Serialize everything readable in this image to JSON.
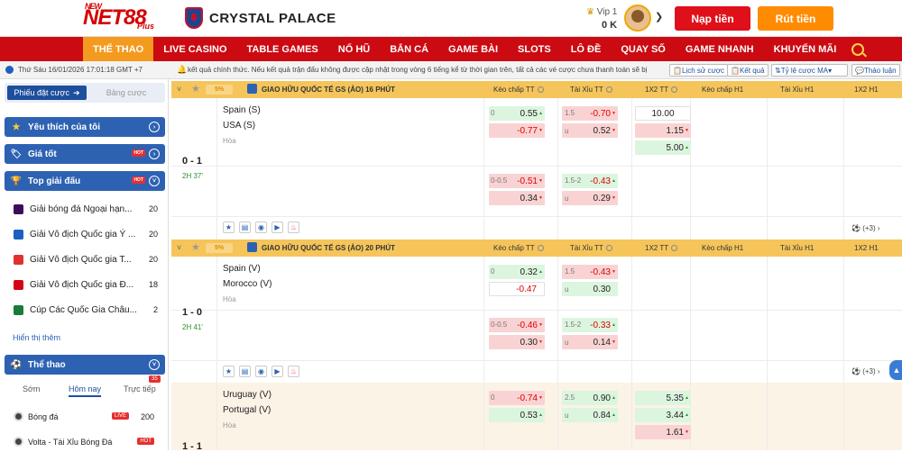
{
  "header": {
    "logo": "NET88",
    "logo_small": "NEW",
    "logo_sub": "Plus",
    "partner": "CRYSTAL PALACE",
    "vip": "Vip 1",
    "balance": "0 K",
    "deposit": "Nạp tiền",
    "withdraw": "Rút tiền"
  },
  "nav": [
    "THỂ THAO",
    "LIVE CASINO",
    "TABLE GAMES",
    "NỔ HŨ",
    "BẮN CÁ",
    "GAME BÀI",
    "SLOTS",
    "LÔ ĐỀ",
    "QUAY SỐ",
    "GAME NHANH",
    "KHUYẾN MÃI"
  ],
  "ticker": {
    "date": "Thứ Sáu 16/01/2026 17:01:18 GMT +7",
    "message": "kết quả chính thức. Nếu kết quả trận đấu không được cập nhật trong vòng 6 tiếng kể từ thời gian trên, tất cả các vé cược chưa thanh toán sẽ bị",
    "history": "Lịch sử cược",
    "results": "Kết quả",
    "odds_type": "Tỷ lệ cược MA",
    "discussion": "Thảo luận"
  },
  "sidebar": {
    "tab_betslip": "Phiếu đặt cược",
    "tab_board": "Bảng cược",
    "favorites": "Yêu thích của tôi",
    "best_odds": "Giá tốt",
    "top_leagues": "Top giải đấu",
    "hot": "HOT",
    "leagues": [
      {
        "name": "Giải bóng đá Ngoại hạn...",
        "count": "20"
      },
      {
        "name": "Giải Vô địch Quốc gia Ý ...",
        "count": "20"
      },
      {
        "name": "Giải Vô địch Quốc gia T...",
        "count": "20"
      },
      {
        "name": "Giải Vô địch Quốc gia Đ...",
        "count": "18"
      },
      {
        "name": "Cúp Các Quốc Gia Châu...",
        "count": "2"
      }
    ],
    "show_more": "Hiển thị thêm",
    "sports": "Thể thao",
    "time_tabs": {
      "early": "Sớm",
      "today": "Hôm nay",
      "live": "Trực tiếp",
      "live_count": "35"
    },
    "sport_rows": [
      {
        "name": "Bóng đá",
        "badge": "LIVE",
        "count": "200"
      },
      {
        "name": "Volta - Tài Xỉu Bóng Đá",
        "badge": "HOT"
      }
    ]
  },
  "columns": {
    "hdp": "Kèo chấp TT",
    "ou": "Tài Xỉu TT",
    "x12": "1X2 TT",
    "hdp_h1": "Kèo chấp H1",
    "ou_h1": "Tài Xỉu H1",
    "x12_h1": "1X2 H1"
  },
  "matches": [
    {
      "league": "GIAO HỮU QUỐC TẾ GS (ẢO) 16 PHÚT",
      "ribbon": "5%",
      "home": "Spain (S)",
      "away": "USA (S)",
      "draw": "Hòa",
      "score": "0 - 1",
      "time": "2H 37'",
      "more": "(+3)",
      "hdp_line": "0",
      "hdp_home": "0.55",
      "hdp_away": "-0.77",
      "ou_line": "1.5",
      "ou_over": "-0.70",
      "ou_under_label": "u",
      "ou_under": "0.52",
      "x1": "10.00",
      "x2": "1.15",
      "xd": "5.00",
      "alt": {
        "hdp_line": "0-0.5",
        "hdp_home": "-0.51",
        "hdp_away": "0.34",
        "ou_line": "1.5-2",
        "ou_over": "-0.43",
        "ou_under_label": "u",
        "ou_under": "0.29"
      }
    },
    {
      "league": "GIAO HỮU QUỐC TẾ GS (ẢO) 20 PHÚT",
      "ribbon": "5%",
      "home": "Spain (V)",
      "away": "Morocco (V)",
      "draw": "Hòa",
      "score": "1 - 0",
      "time": "2H 41'",
      "more": "(+3)",
      "hdp_line": "0",
      "hdp_home": "0.32",
      "hdp_away": "-0.47",
      "ou_line": "1.5",
      "ou_over": "-0.43",
      "ou_under_label": "u",
      "ou_under": "0.30",
      "alt": {
        "hdp_line": "0-0.5",
        "hdp_home": "-0.46",
        "hdp_away": "0.30",
        "ou_line": "1.5-2",
        "ou_over": "-0.33",
        "ou_under_label": "u",
        "ou_under": "0.14"
      }
    },
    {
      "home": "Uruguay (V)",
      "away": "Portugal (V)",
      "draw": "Hòa",
      "score": "1 - 1",
      "hdp_line": "0",
      "hdp_home": "-0.74",
      "hdp_away": "0.53",
      "ou_line": "2.5",
      "ou_over": "0.90",
      "ou_under_label": "u",
      "ou_under": "0.84",
      "x1": "5.35",
      "x2": "3.44",
      "xd": "1.61"
    }
  ],
  "colors": {
    "brand_red": "#cc0a12",
    "nav_active": "#f39a1f",
    "league_header": "#f5c55b",
    "sidebar_blue": "#2d62b3",
    "up": "#dcf5df",
    "down": "#f9d3d3"
  }
}
